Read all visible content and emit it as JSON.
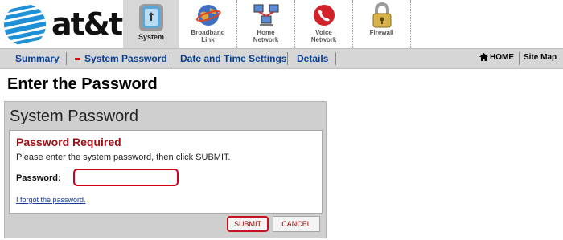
{
  "brand": {
    "logo_text": "at&t"
  },
  "nav_tabs": [
    {
      "label": "System",
      "icon": "system-phone-icon",
      "active": true
    },
    {
      "label": "Broadband Link",
      "icon": "broadband-globe-icon",
      "active": false
    },
    {
      "label": "Home Network",
      "icon": "home-network-icon",
      "active": false
    },
    {
      "label": "Voice Network",
      "icon": "voice-phone-icon",
      "active": false
    },
    {
      "label": "Firewall",
      "icon": "padlock-icon",
      "active": false
    }
  ],
  "subnav": {
    "items": [
      {
        "label": "Summary"
      },
      {
        "label": "System Password",
        "selected": true
      },
      {
        "label": "Date and Time Settings"
      },
      {
        "label": "Details"
      }
    ],
    "home_label": "HOME",
    "sitemap_label": "Site Map"
  },
  "page": {
    "title": "Enter the Password"
  },
  "panel": {
    "title": "System Password",
    "heading": "Password Required",
    "instructions": "Please enter the system password, then click SUBMIT.",
    "password_label": "Password:",
    "password_value": "",
    "forgot_link": "I forgot the password.",
    "submit_label": "SUBMIT",
    "cancel_label": "CANCEL"
  },
  "colors": {
    "accent_red": "#c8101e",
    "link_blue": "#0b3d91",
    "toolbar_gray": "#d6d6d6",
    "globe_blue": "#1f8fd6"
  }
}
